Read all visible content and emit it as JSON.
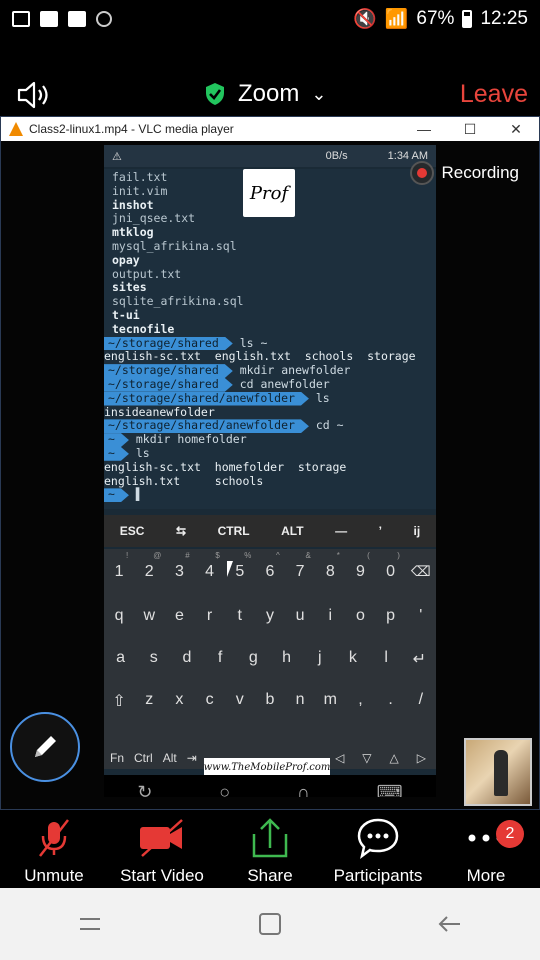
{
  "status_bar": {
    "battery": "67%",
    "time": "12:25"
  },
  "zoom_header": {
    "title": "Zoom",
    "leave_label": "Leave"
  },
  "vlc": {
    "window_title": "Class2-linux1.mp4 - VLC media player",
    "recording_label": "Recording"
  },
  "phone": {
    "status_left": "0B/s",
    "status_time": "1:34 AM",
    "logo_text": "Prof",
    "terminal_lines": [
      {
        "text": "fail.txt",
        "style": "indent"
      },
      {
        "text": "init.vim",
        "style": "indent"
      },
      {
        "text": "inshot",
        "style": "indent bold"
      },
      {
        "text": "jni_qsee.txt",
        "style": "indent"
      },
      {
        "text": "mtklog",
        "style": "indent bold"
      },
      {
        "text": "mysql_afrikina.sql",
        "style": "indent"
      },
      {
        "text": "opay",
        "style": "indent bold"
      },
      {
        "text": "output.txt",
        "style": "indent"
      },
      {
        "text": "sites",
        "style": "indent bold"
      },
      {
        "text": "sqlite_afrikina.sql",
        "style": "indent"
      },
      {
        "text": "t-ui",
        "style": "indent bold"
      },
      {
        "text": "tecnofile",
        "style": "indent bold"
      }
    ],
    "session": [
      {
        "prompt": "~/storage/shared",
        "cmd": "ls ~"
      },
      {
        "out": "english-sc.txt  english.txt  schools  storage"
      },
      {
        "prompt": "~/storage/shared",
        "cmd": "mkdir anewfolder"
      },
      {
        "prompt": "~/storage/shared",
        "cmd": "cd anewfolder"
      },
      {
        "prompt": "~/storage/shared/anewfolder",
        "cmd": "ls"
      },
      {
        "out": "insideanewfolder"
      },
      {
        "prompt": "~/storage/shared/anewfolder",
        "cmd": "cd ~"
      },
      {
        "prompt": "~",
        "cmd": "mkdir homefolder"
      },
      {
        "prompt": "~",
        "cmd": "ls"
      },
      {
        "out": "english-sc.txt  homefolder  storage"
      },
      {
        "out": "english.txt     schools"
      },
      {
        "prompt": "~",
        "cmd": "▌"
      }
    ],
    "extra_keys": [
      "ESC",
      "⇆",
      "CTRL",
      "ALT",
      "—",
      "’",
      "ij"
    ],
    "key_rows": [
      {
        "keys": [
          "1",
          "2",
          "3",
          "4",
          "5",
          "6",
          "7",
          "8",
          "9",
          "0",
          "⌫"
        ],
        "subs": [
          "!",
          "@",
          "#",
          "$",
          "%",
          "^",
          "&",
          "*",
          "(",
          ")",
          ""
        ]
      },
      {
        "keys": [
          "q",
          "w",
          "e",
          "r",
          "t",
          "y",
          "u",
          "i",
          "o",
          "p",
          "'"
        ],
        "subs": []
      },
      {
        "keys": [
          "a",
          "s",
          "d",
          "f",
          "g",
          "h",
          "j",
          "k",
          "l",
          "↵"
        ],
        "subs": []
      },
      {
        "keys": [
          "⇧",
          "z",
          "x",
          "c",
          "v",
          "b",
          "n",
          "m",
          ",",
          ".",
          "/"
        ],
        "subs": []
      }
    ],
    "keyboard_bottom": {
      "fn": "Fn",
      "ctrl": "Ctrl",
      "alt": "Alt",
      "tab": "⇥",
      "arrows": [
        "◁",
        "▽",
        "△",
        "▷"
      ]
    },
    "watermark": "www.TheMobileProf.com",
    "nav_icons": [
      "↻",
      "○",
      "∩",
      "⌨"
    ]
  },
  "controls": [
    {
      "name": "unmute",
      "label": "Unmute",
      "icon": "muted-mic-icon",
      "color": "#e53935"
    },
    {
      "name": "start-video",
      "label": "Start Video",
      "icon": "video-off-icon",
      "color": "#e53935"
    },
    {
      "name": "share",
      "label": "Share",
      "icon": "share-icon",
      "color": "#3fb950"
    },
    {
      "name": "participants",
      "label": "Participants",
      "icon": "chat-bubble-icon",
      "color": "#ffffff"
    },
    {
      "name": "more",
      "label": "More",
      "icon": "more-dots-icon",
      "color": "#ffffff",
      "badge": "2"
    }
  ],
  "colors": {
    "leave": "#e8453c",
    "accent_blue": "#4a90e2",
    "shield_green": "#22c55e"
  }
}
